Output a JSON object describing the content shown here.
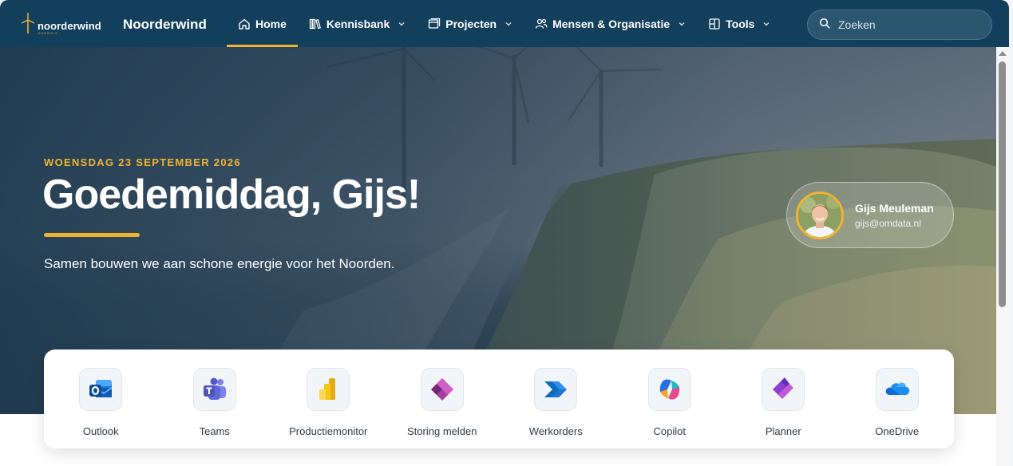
{
  "brand": {
    "logo_text": "noorderwind",
    "logo_sub": "ENERGIE",
    "site_title": "Noorderwind",
    "accent": "#f1b430",
    "nav_bg": "#123f5c"
  },
  "nav": {
    "items": [
      {
        "label": "Home",
        "icon": "home-icon",
        "active": true
      },
      {
        "label": "Kennisbank",
        "icon": "library-icon",
        "dropdown": true
      },
      {
        "label": "Projecten",
        "icon": "folders-icon",
        "dropdown": true
      },
      {
        "label": "Mensen & Organisatie",
        "icon": "people-icon",
        "dropdown": true
      },
      {
        "label": "Tools",
        "icon": "tools-icon",
        "dropdown": true
      }
    ]
  },
  "search": {
    "placeholder": "Zoeken",
    "value": ""
  },
  "hero": {
    "date": "WOENSDAG 23 SEPTEMBER 2026",
    "greeting": "Goedemiddag, Gijs!",
    "tagline": "Samen bouwen we aan schone energie voor het Noorden."
  },
  "user": {
    "name": "Gijs Meuleman",
    "email": "gijs@omdata.nl"
  },
  "apps": [
    {
      "label": "Outlook",
      "icon": "outlook-icon"
    },
    {
      "label": "Teams",
      "icon": "teams-icon"
    },
    {
      "label": "Productiemonitor",
      "icon": "power-bi-icon"
    },
    {
      "label": "Storing melden",
      "icon": "power-apps-icon"
    },
    {
      "label": "Werkorders",
      "icon": "power-automate-icon"
    },
    {
      "label": "Copilot",
      "icon": "copilot-icon"
    },
    {
      "label": "Planner",
      "icon": "planner-icon"
    },
    {
      "label": "OneDrive",
      "icon": "onedrive-icon"
    }
  ]
}
